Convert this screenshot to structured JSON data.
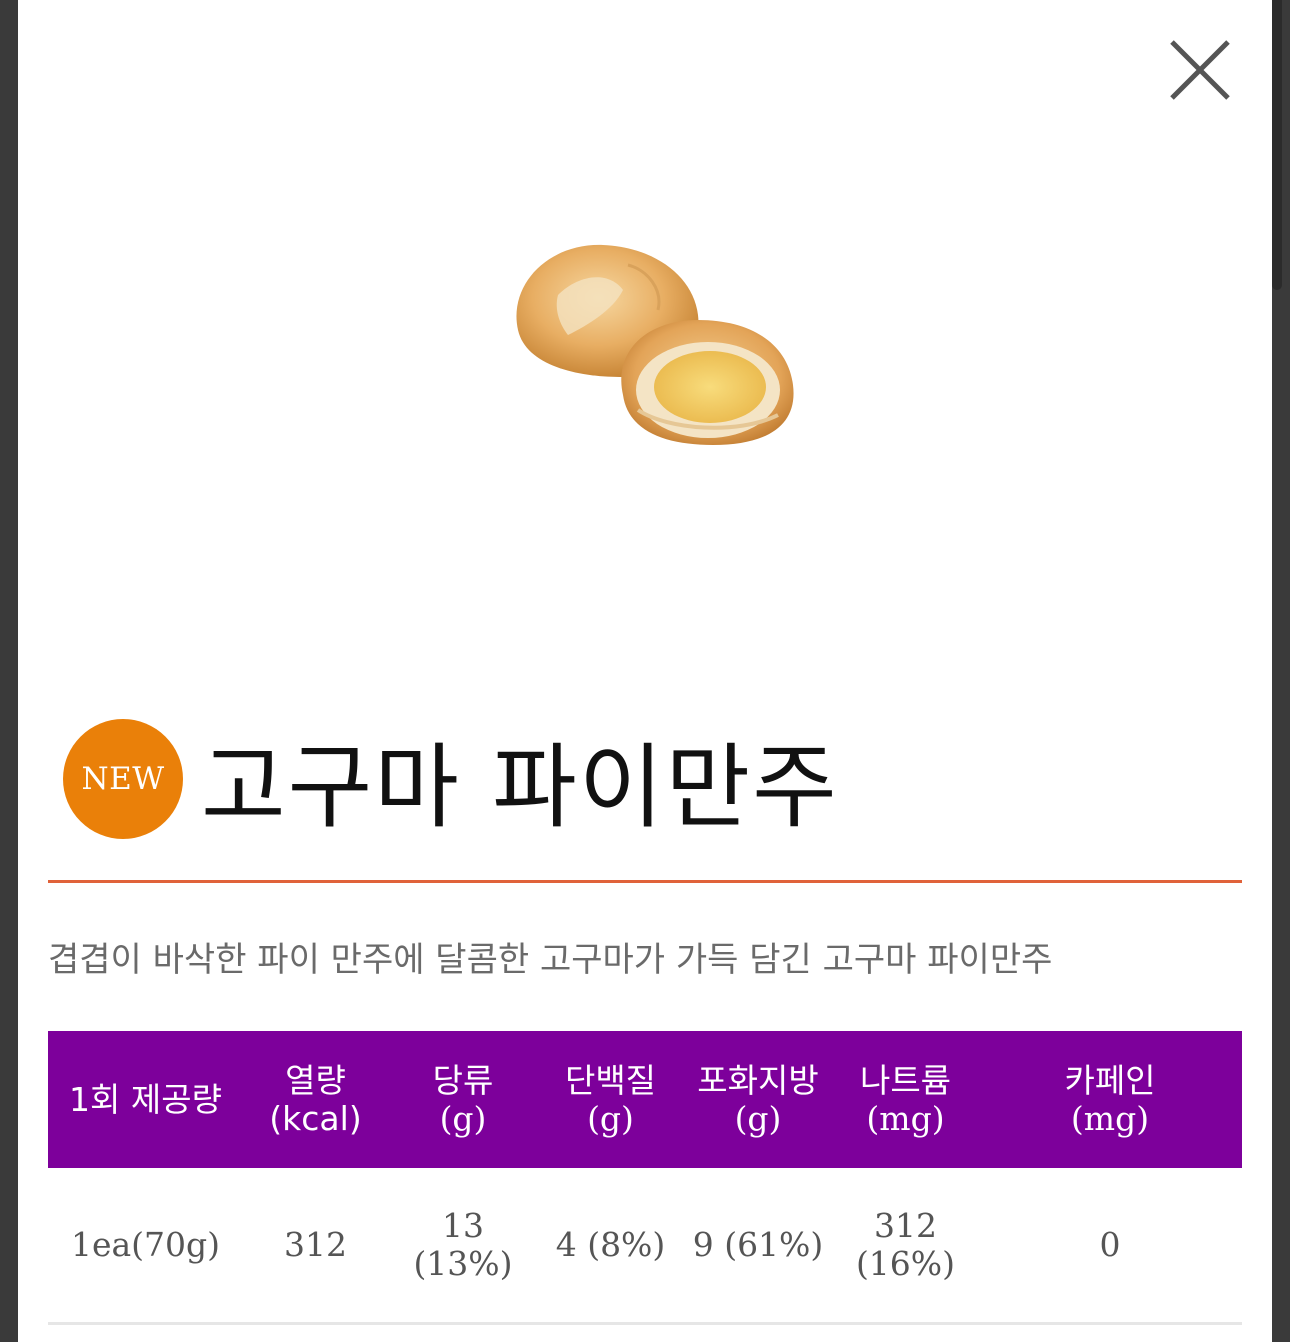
{
  "modal": {
    "close_icon": "close-icon"
  },
  "product": {
    "badge": "NEW",
    "title": "고구마 파이만주",
    "description": "겹겹이 바삭한 파이 만주에 달콤한 고구마가 가득 담긴 고구마 파이만주",
    "image": "sweet-potato-pie-manju-photo"
  },
  "colors": {
    "badge": "#ea8009",
    "divider": "#e0623a",
    "table_header": "#7d009b"
  },
  "nutrition": {
    "headers": [
      {
        "label": "1회 제공량",
        "unit": ""
      },
      {
        "label": "열량(kcal)",
        "unit": ""
      },
      {
        "label": "당류",
        "unit": "(g)"
      },
      {
        "label": "단백질",
        "unit": "(g)"
      },
      {
        "label": "포화지방",
        "unit": "(g)"
      },
      {
        "label": "나트륨",
        "unit": "(mg)"
      },
      {
        "label": "카페인",
        "unit": "(mg)"
      }
    ],
    "values": [
      {
        "main": "1ea(70g)",
        "sub": ""
      },
      {
        "main": "312",
        "sub": ""
      },
      {
        "main": "13",
        "sub": "(13%)"
      },
      {
        "main": "4 (8%)",
        "sub": ""
      },
      {
        "main": "9 (61%)",
        "sub": ""
      },
      {
        "main": "312",
        "sub": "(16%)"
      },
      {
        "main": "0",
        "sub": ""
      }
    ]
  }
}
